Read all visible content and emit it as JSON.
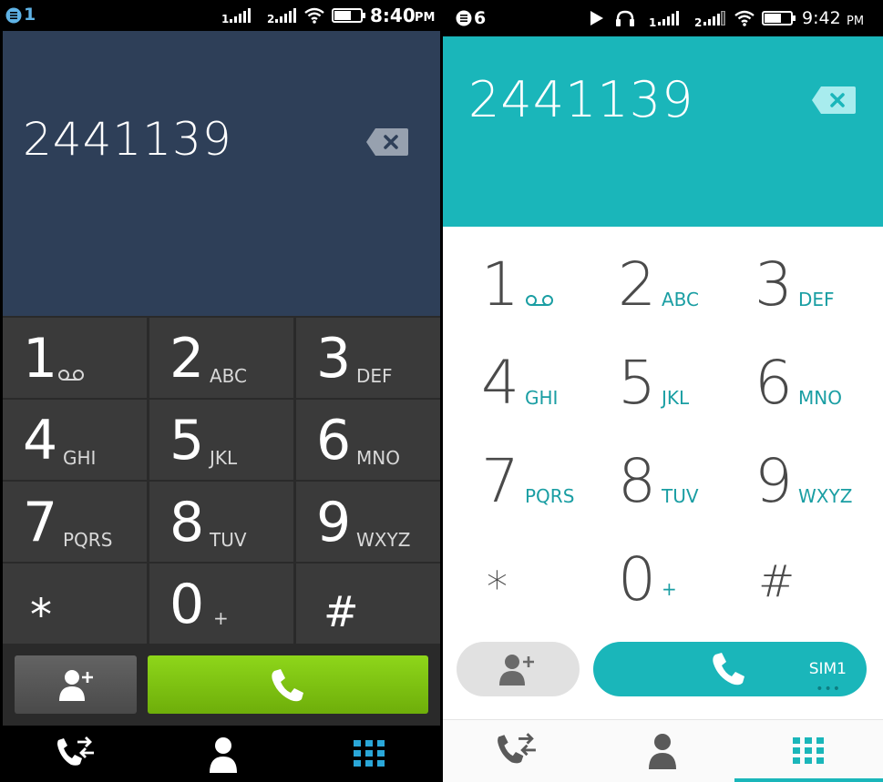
{
  "left": {
    "status": {
      "notification_count": "1",
      "sim1_label": "1",
      "sim2_label": "2",
      "time": "8:40",
      "ampm": "PM"
    },
    "display": {
      "number": "2441139"
    },
    "keys": [
      {
        "digit": "1",
        "letters": "",
        "icon": "voicemail-icon"
      },
      {
        "digit": "2",
        "letters": "ABC"
      },
      {
        "digit": "3",
        "letters": "DEF"
      },
      {
        "digit": "4",
        "letters": "GHI"
      },
      {
        "digit": "5",
        "letters": "JKL"
      },
      {
        "digit": "6",
        "letters": "MNO"
      },
      {
        "digit": "7",
        "letters": "PQRS"
      },
      {
        "digit": "8",
        "letters": "TUV"
      },
      {
        "digit": "9",
        "letters": "WXYZ"
      },
      {
        "digit": "*",
        "letters": ""
      },
      {
        "digit": "0",
        "letters": "+"
      },
      {
        "digit": "#",
        "letters": ""
      }
    ],
    "colors": {
      "display_bg": "#2e3f58",
      "call_button": "#7cc212",
      "active_tab": "#2aa7d8"
    }
  },
  "right": {
    "status": {
      "notification_count": "6",
      "sim1_label": "1",
      "sim2_label": "2",
      "time": "9:42",
      "ampm": "PM"
    },
    "display": {
      "number": "2441139"
    },
    "keys": [
      {
        "digit": "1",
        "letters": "",
        "icon": "voicemail-icon"
      },
      {
        "digit": "2",
        "letters": "ABC"
      },
      {
        "digit": "3",
        "letters": "DEF"
      },
      {
        "digit": "4",
        "letters": "GHI"
      },
      {
        "digit": "5",
        "letters": "JKL"
      },
      {
        "digit": "6",
        "letters": "MNO"
      },
      {
        "digit": "7",
        "letters": "PQRS"
      },
      {
        "digit": "8",
        "letters": "TUV"
      },
      {
        "digit": "9",
        "letters": "WXYZ"
      },
      {
        "digit": "*",
        "letters": ""
      },
      {
        "digit": "0",
        "letters": "+"
      },
      {
        "digit": "#",
        "letters": ""
      }
    ],
    "call": {
      "sim_label": "SIM1",
      "more": "•••"
    },
    "colors": {
      "accent": "#1ab6ba",
      "letters": "#1a9ea3"
    }
  }
}
